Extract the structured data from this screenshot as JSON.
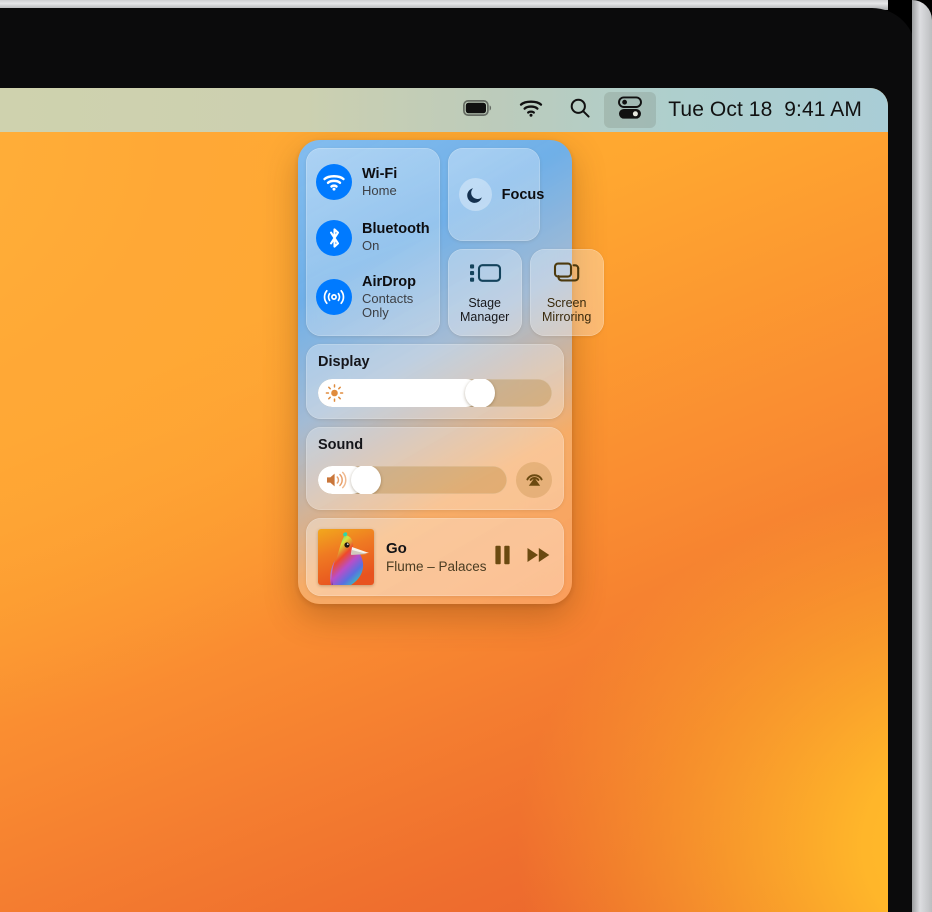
{
  "menubar": {
    "items": [
      {
        "name": "battery-icon",
        "label": "Battery"
      },
      {
        "name": "wifi-icon",
        "label": "Wi-Fi"
      },
      {
        "name": "search-icon",
        "label": "Spotlight Search"
      },
      {
        "name": "control-center-icon",
        "label": "Control Center"
      }
    ],
    "clock": "Tue Oct 18  9:41 AM"
  },
  "control_center": {
    "connectivity": [
      {
        "icon": "wifi-icon",
        "title": "Wi-Fi",
        "status": "Home"
      },
      {
        "icon": "bluetooth-icon",
        "title": "Bluetooth",
        "status": "On"
      },
      {
        "icon": "airdrop-icon",
        "title": "AirDrop",
        "status": "Contacts Only"
      }
    ],
    "focus": {
      "icon": "moon-icon",
      "label": "Focus"
    },
    "stage_manager": {
      "icon": "stage-manager-icon",
      "label": "Stage\nManager",
      "line1": "Stage",
      "line2": "Manager"
    },
    "screen_mirroring": {
      "icon": "screen-mirroring-icon",
      "label": "Screen\nMirroring",
      "line1": "Screen",
      "line2": "Mirroring"
    },
    "display": {
      "heading": "Display",
      "icon": "brightness-icon",
      "value_percent": 72
    },
    "sound": {
      "heading": "Sound",
      "icon": "speaker-icon",
      "value_percent": 21,
      "output_button": {
        "icon": "airplay-audio-icon",
        "label": "Sound Output"
      }
    },
    "now_playing": {
      "title": "Go",
      "artist": "Flume – Palaces",
      "artwork_name": "album-artwork-palaces",
      "controls": [
        {
          "name": "pause-button",
          "label": "Pause"
        },
        {
          "name": "fast-forward-button",
          "label": "Fast Forward"
        }
      ]
    }
  },
  "colors": {
    "accent_blue": "#007AFF",
    "menubar_tint": "#c6cfb4",
    "wallpaper_orange": "#ffb02e",
    "focus_moon": "#14304f"
  }
}
